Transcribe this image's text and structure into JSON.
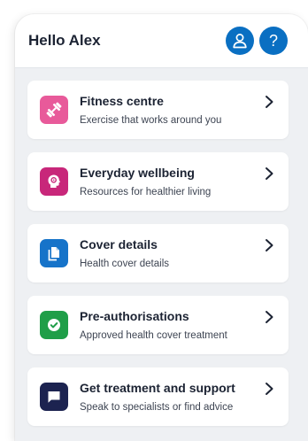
{
  "header": {
    "greeting": "Hello Alex",
    "profile_icon": "person-icon",
    "help_icon": "question-icon",
    "help_glyph": "?",
    "button_color": "#0a6fc2"
  },
  "cards": [
    {
      "title": "Fitness centre",
      "subtitle": "Exercise that works around you",
      "icon": "dumbbell-icon",
      "icon_color": "#e85a9a"
    },
    {
      "title": "Everyday wellbeing",
      "subtitle": "Resources for healthier living",
      "icon": "head-icon",
      "icon_color": "#c8277a"
    },
    {
      "title": "Cover details",
      "subtitle": "Health cover details",
      "icon": "document-icon",
      "icon_color": "#1673c9"
    },
    {
      "title": "Pre-authorisations",
      "subtitle": "Approved health cover treatment",
      "icon": "check-badge-icon",
      "icon_color": "#1f9e48"
    },
    {
      "title": "Get treatment and support",
      "subtitle": "Speak to specialists or find advice",
      "icon": "chat-bubble-icon",
      "icon_color": "#1c2350"
    }
  ]
}
